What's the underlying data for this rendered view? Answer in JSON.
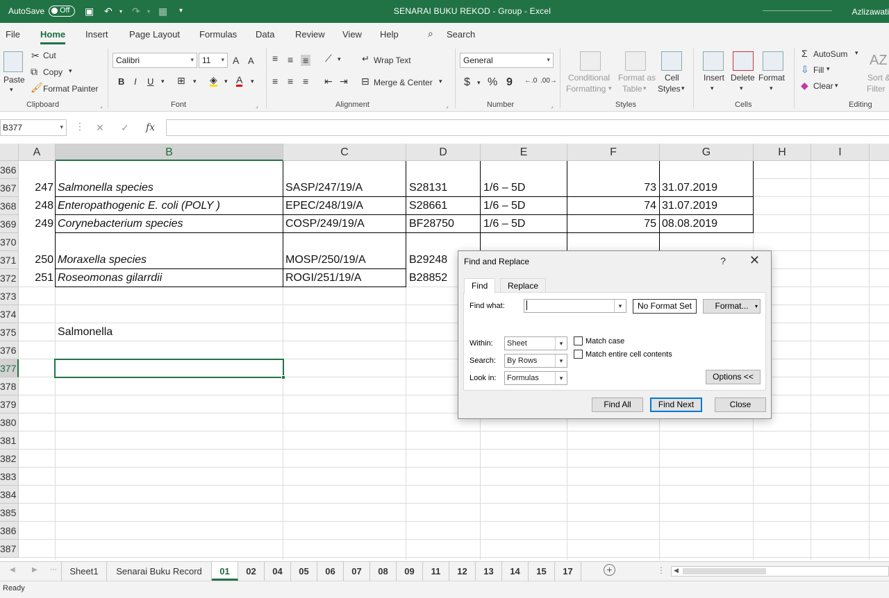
{
  "titlebar": {
    "autosave_label": "AutoSave",
    "autosave_state": "Off",
    "window_title": "SENARAI BUKU REKOD  -  Group  -  Excel",
    "user": "Azlizawati"
  },
  "menu": {
    "tabs": [
      "File",
      "Home",
      "Insert",
      "Page Layout",
      "Formulas",
      "Data",
      "Review",
      "View",
      "Help"
    ],
    "active": "Home",
    "search": "Search"
  },
  "ribbon": {
    "clipboard": {
      "paste": "Paste",
      "cut": "Cut",
      "copy": "Copy",
      "format_painter": "Format Painter",
      "label": "Clipboard"
    },
    "font": {
      "name": "Calibri",
      "size": "11",
      "bold": "B",
      "italic": "I",
      "underline": "U",
      "grow": "A",
      "shrink": "A",
      "label": "Font"
    },
    "alignment": {
      "wrap": "Wrap Text",
      "merge": "Merge & Center",
      "label": "Alignment"
    },
    "number": {
      "format": "General",
      "currency": "$",
      "percent": "%",
      "comma": "9",
      "label": "Number"
    },
    "styles": {
      "conditional_1": "Conditional",
      "conditional_2": "Formatting",
      "format_table_1": "Format as",
      "format_table_2": "Table",
      "cell_styles_1": "Cell",
      "cell_styles_2": "Styles",
      "label": "Styles"
    },
    "cells": {
      "insert": "Insert",
      "delete": "Delete",
      "format": "Format",
      "label": "Cells"
    },
    "editing": {
      "autosum": "AutoSum",
      "fill": "Fill",
      "clear": "Clear",
      "sort_1": "Sort &",
      "sort_2": "Filter",
      "label": "Editing"
    }
  },
  "formula_bar": {
    "name_box": "B377",
    "fx": "fx",
    "value": ""
  },
  "grid": {
    "columns": [
      "A",
      "B",
      "C",
      "D",
      "E",
      "F",
      "G",
      "H",
      "I"
    ],
    "selected_column": "B",
    "rows": [
      "366",
      "367",
      "368",
      "369",
      "370",
      "371",
      "372",
      "373",
      "374",
      "375",
      "376",
      "377",
      "378",
      "379",
      "380",
      "381",
      "382",
      "383",
      "384",
      "385",
      "386",
      "387"
    ],
    "selected_row": "377",
    "records": [
      {
        "a": "247",
        "b": "Salmonella species",
        "c": "SASP/247/19/A",
        "d": "S28131",
        "e": "1/6 – 5D",
        "f": "73",
        "g": "31.07.2019"
      },
      {
        "a": "248",
        "b": "Enteropathogenic E. coli (POLY )",
        "c": "EPEC/248/19/A",
        "d": "S28661",
        "e": "1/6 – 5D",
        "f": "74",
        "g": "31.07.2019"
      },
      {
        "a": "249",
        "b": "Corynebacterium species",
        "c": "COSP/249/19/A",
        "d": "BF28750",
        "e": "1/6 – 5D",
        "f": "75",
        "g": "08.08.2019"
      },
      {
        "a": "250",
        "b": "Moraxella species",
        "c": "MOSP/250/19/A",
        "d": "B29248"
      },
      {
        "a": "251",
        "b": "Roseomonas gilarrdii",
        "c": "ROGI/251/19/A",
        "d": "B28852"
      }
    ],
    "cell_b375": "Salmonella"
  },
  "sheets": {
    "tabs": [
      "Sheet1",
      "Senarai Buku Record",
      "01",
      "02",
      "04",
      "05",
      "06",
      "07",
      "08",
      "09",
      "11",
      "12",
      "13",
      "14",
      "15",
      "17"
    ],
    "active": "01"
  },
  "status": "Ready",
  "dialog": {
    "title": "Find and Replace",
    "help": "?",
    "tabs": {
      "find": "Find",
      "replace": "Replace"
    },
    "find_what_label": "Find what:",
    "find_what_value": "",
    "no_format": "No Format Set",
    "format_btn": "Format...",
    "within_label": "Within:",
    "within_value": "Sheet",
    "search_label": "Search:",
    "search_value": "By Rows",
    "lookin_label": "Look in:",
    "lookin_value": "Formulas",
    "match_case": "Match case",
    "match_entire": "Match entire cell contents",
    "options_btn": "Options <<",
    "find_all": "Find All",
    "find_next": "Find Next",
    "close": "Close"
  }
}
